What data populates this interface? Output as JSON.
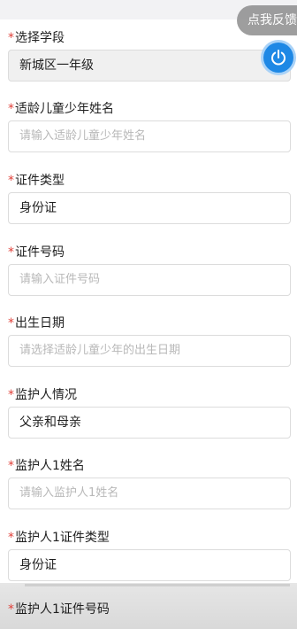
{
  "feedback": {
    "label": "点我反馈"
  },
  "fields": [
    {
      "label": "选择学段",
      "value": "新城区一年级",
      "placeholder": "",
      "style": "filled"
    },
    {
      "label": "适龄儿童少年姓名",
      "value": "",
      "placeholder": "请输入适龄儿童少年姓名",
      "style": "input"
    },
    {
      "label": "证件类型",
      "value": "身份证",
      "placeholder": "",
      "style": "select"
    },
    {
      "label": "证件号码",
      "value": "",
      "placeholder": "请输入证件号码",
      "style": "input"
    },
    {
      "label": "出生日期",
      "value": "",
      "placeholder": "请选择适龄儿童少年的出生日期",
      "style": "input"
    },
    {
      "label": "监护人情况",
      "value": "父亲和母亲",
      "placeholder": "",
      "style": "select"
    },
    {
      "label": "监护人1姓名",
      "value": "",
      "placeholder": "请输入监护人1姓名",
      "style": "input"
    },
    {
      "label": "监护人1证件类型",
      "value": "身份证",
      "placeholder": "",
      "style": "select"
    },
    {
      "label": "监护人1证件号码",
      "value": "",
      "placeholder": "",
      "style": "label-only"
    }
  ],
  "required_mark": "*",
  "colors": {
    "required": "#e0413a",
    "accent": "#1e88e5",
    "placeholder": "#b8b8b8"
  },
  "icons": {
    "power": "power-icon"
  }
}
